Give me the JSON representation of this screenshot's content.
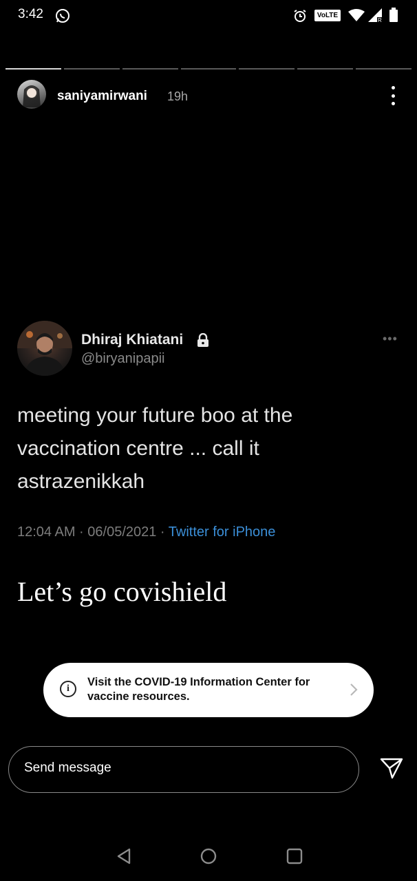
{
  "status_bar": {
    "time": "3:42",
    "volte_label": "VoLTE",
    "icons": [
      "whatsapp-icon",
      "alarm-icon",
      "volte-icon",
      "wifi-icon",
      "signal-icon",
      "battery-icon"
    ]
  },
  "story": {
    "username": "saniyamirwani",
    "time_ago": "19h",
    "segments_total": 7,
    "active_segment": 1
  },
  "tweet": {
    "author_name": "Dhiraj Khiatani",
    "handle": "@biryanipapii",
    "more": "•••",
    "body": "meeting your future boo at the vaccination centre ... call it astrazenikkah",
    "timestamp": "12:04 AM · 06/05/2021 · ",
    "source": "Twitter for iPhone"
  },
  "caption": "Let’s go covishield",
  "banner": {
    "text": "Visit the COVID-19 Information Center for vaccine resources.",
    "info_glyph": "i"
  },
  "reply": {
    "placeholder": "Send message"
  },
  "colors": {
    "background": "#000000",
    "link_blue": "#3b8fd8",
    "banner_bg": "#ffffff"
  }
}
